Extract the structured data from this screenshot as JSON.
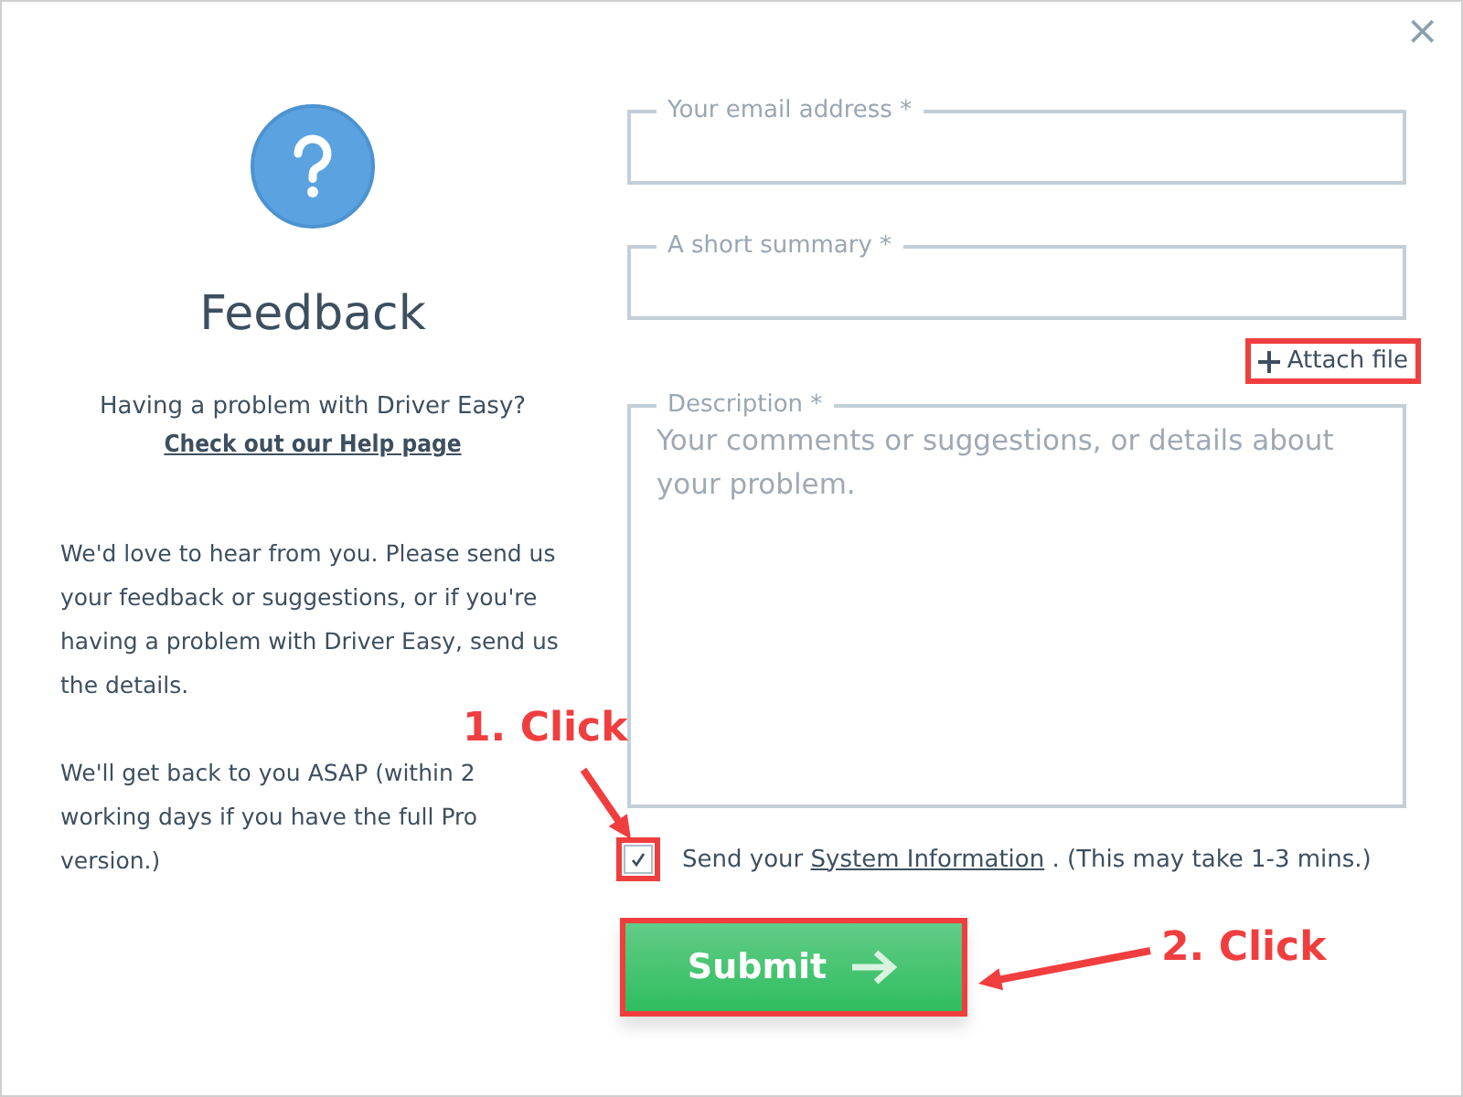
{
  "dialog": {
    "close_label": "×"
  },
  "sidebar": {
    "title": "Feedback",
    "question": "Having a problem with Driver Easy?",
    "help_link": "Check out our Help page",
    "paragraphs": [
      "We'd love to hear from you. Please send us your feedback or suggestions, or if you're having a problem with Driver Easy, send us the details.",
      "We'll get back to you ASAP (within 2 working days if you have the full Pro version.)"
    ]
  },
  "form": {
    "fields": [
      {
        "kind": "input",
        "legend": "Your email address *"
      },
      {
        "kind": "input",
        "legend": "A short summary *"
      },
      {
        "kind": "textarea",
        "legend": "Description *",
        "placeholder": "Your comments or suggestions, or details about your problem."
      }
    ],
    "attach_label": "Attach file",
    "system_info": {
      "checked": true,
      "prefix": "Send your",
      "link": "System Information",
      "suffix": ". (This may take 1-3 mins.)"
    },
    "submit_label": "Submit"
  },
  "annotations": [
    {
      "label": "1. Click"
    },
    {
      "label": "2. Click"
    }
  ]
}
